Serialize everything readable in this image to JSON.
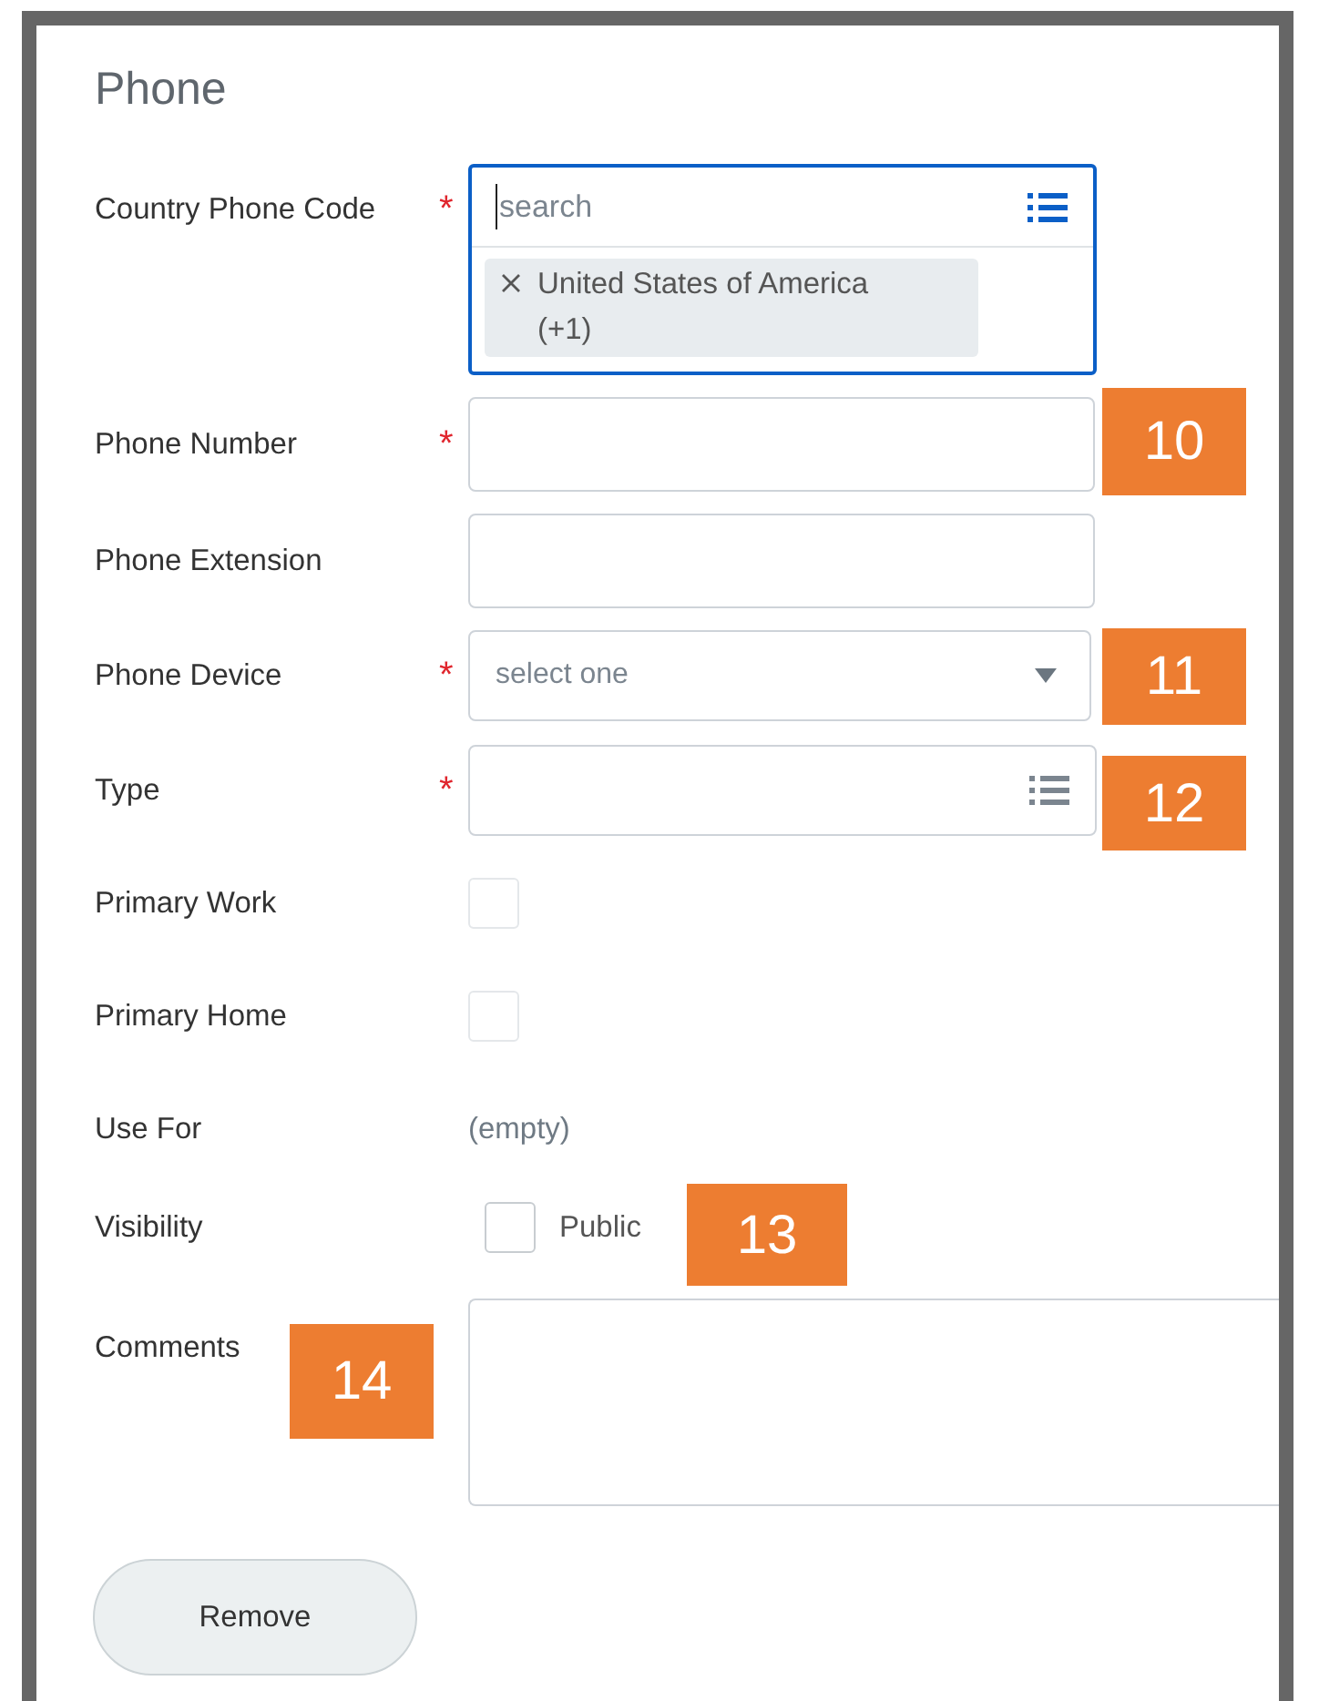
{
  "title": "Phone",
  "fields": [
    {
      "kind": "multiselect",
      "label": "Country Phone Code",
      "required_mark": "*",
      "placeholder": "search",
      "chips": [
        "United States of America (+1)"
      ]
    },
    {
      "kind": "text",
      "label": "Phone Number",
      "required_mark": "*"
    },
    {
      "kind": "text",
      "label": "Phone Extension"
    },
    {
      "kind": "select",
      "label": "Phone Device",
      "required_mark": "*",
      "placeholder": "select one"
    },
    {
      "kind": "prompt",
      "label": "Type",
      "required_mark": "*"
    },
    {
      "kind": "checkbox",
      "label": "Primary Work",
      "checked": false
    },
    {
      "kind": "checkbox",
      "label": "Primary Home",
      "checked": false
    },
    {
      "kind": "readonly",
      "label": "Use For",
      "value": "(empty)"
    },
    {
      "kind": "labeled_checkbox",
      "label": "Visibility",
      "option": "Public",
      "checked": false
    },
    {
      "kind": "textarea",
      "label": "Comments"
    }
  ],
  "remove_button": "Remove",
  "callouts": [
    "10",
    "11",
    "12",
    "13",
    "14"
  ]
}
